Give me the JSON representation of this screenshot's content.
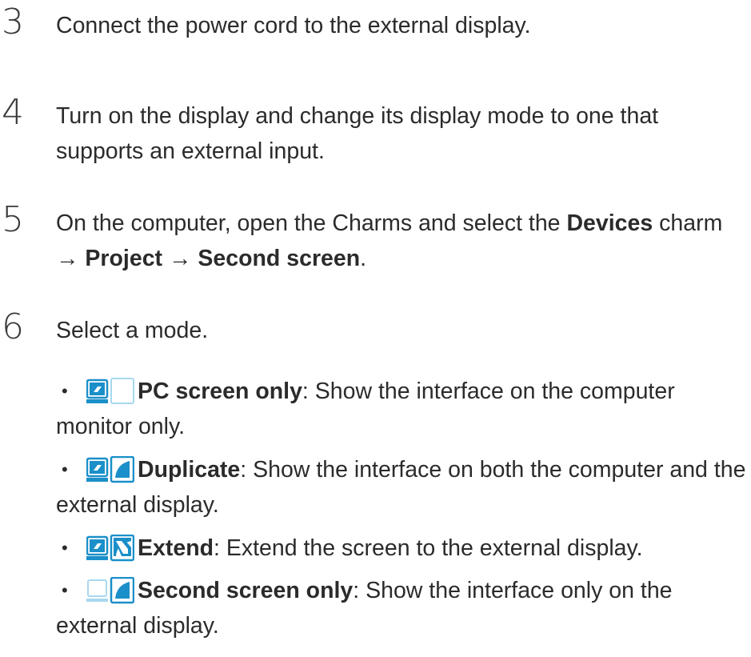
{
  "colors": {
    "text": "#2b2b2b",
    "icon_blue": "#1a8fc9",
    "icon_light": "#a8d8ee"
  },
  "steps": [
    {
      "num": "3",
      "text": "Connect the power cord to the external display."
    },
    {
      "num": "4",
      "text": "Turn on the display and change its display mode to one that supports an external input."
    },
    {
      "num": "5",
      "pre": "On the computer, open the Charms and select the ",
      "b1": "Devices",
      "mid1": " charm → ",
      "b2": "Project",
      "mid2": " → ",
      "b3": "Second screen",
      "post": "."
    },
    {
      "num": "6",
      "text": "Select a mode."
    }
  ],
  "modes": [
    {
      "dot": "•",
      "icon": "pc-screen-only-icon",
      "name": "PC screen only",
      "desc": ": Show the interface on the computer monitor only."
    },
    {
      "dot": "•",
      "icon": "duplicate-icon",
      "name": "Duplicate",
      "desc": ": Show the interface on both the computer and the external display."
    },
    {
      "dot": "•",
      "icon": "extend-icon",
      "name": "Extend",
      "desc": ": Extend the screen to the external display."
    },
    {
      "dot": "•",
      "icon": "second-screen-only-icon",
      "name": "Second screen only",
      "desc": ": Show the interface only on the external display."
    }
  ]
}
